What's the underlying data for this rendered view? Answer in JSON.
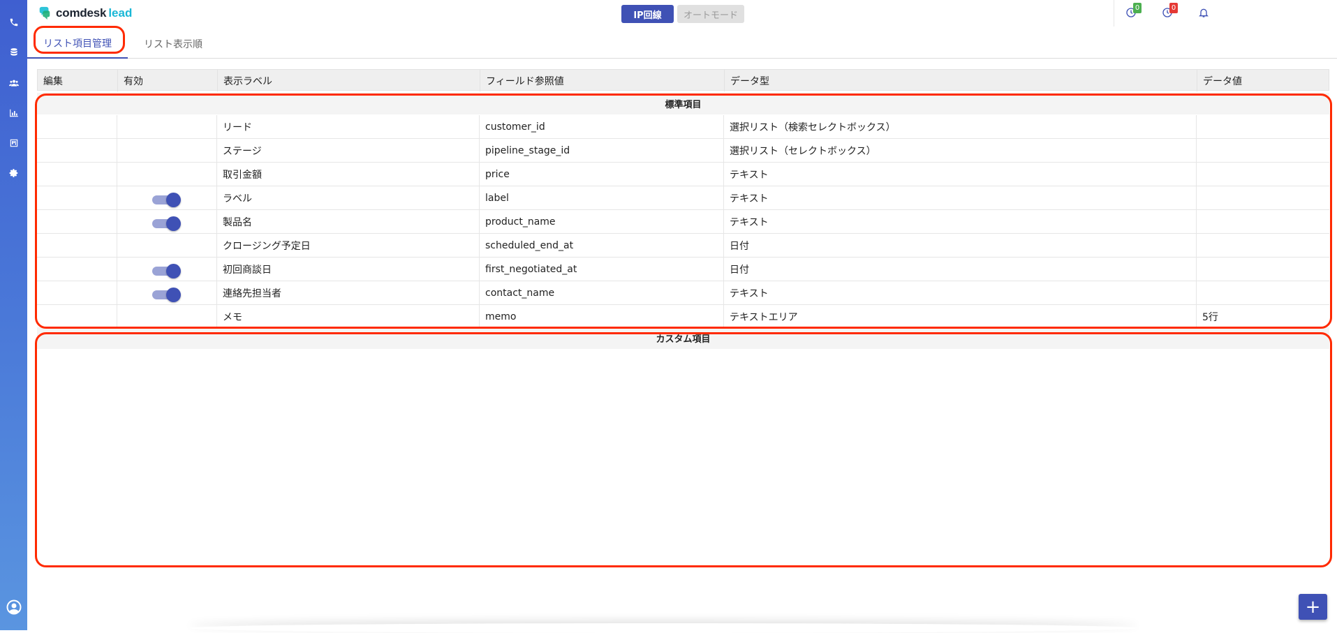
{
  "app": {
    "logo_text": "comdesk",
    "logo_accent": "lead"
  },
  "header": {
    "mode_ip": "IP回線",
    "mode_auto": "オートモード",
    "badge_1": "0",
    "badge_2": "0",
    "colors": {
      "primary": "#3f51b5",
      "badge_green": "#4caf50",
      "badge_red": "#e53935"
    }
  },
  "tabs": [
    {
      "label": "リスト項目管理",
      "active": true
    },
    {
      "label": "リスト表示順",
      "active": false
    }
  ],
  "table": {
    "columns": [
      "編集",
      "有効",
      "表示ラベル",
      "フィールド参照値",
      "データ型",
      "データ値"
    ],
    "standard_section_title": "標準項目",
    "custom_section_title": "カスタム項目",
    "rows": [
      {
        "enabled": false,
        "label": "リード",
        "field": "customer_id",
        "type": "選択リスト（検索セレクトボックス）",
        "value": ""
      },
      {
        "enabled": false,
        "label": "ステージ",
        "field": "pipeline_stage_id",
        "type": "選択リスト（セレクトボックス）",
        "value": ""
      },
      {
        "enabled": false,
        "label": "取引金額",
        "field": "price",
        "type": "テキスト",
        "value": ""
      },
      {
        "enabled": true,
        "label": "ラベル",
        "field": "label",
        "type": "テキスト",
        "value": ""
      },
      {
        "enabled": true,
        "label": "製品名",
        "field": "product_name",
        "type": "テキスト",
        "value": ""
      },
      {
        "enabled": false,
        "label": "クロージング予定日",
        "field": "scheduled_end_at",
        "type": "日付",
        "value": ""
      },
      {
        "enabled": true,
        "label": "初回商談日",
        "field": "first_negotiated_at",
        "type": "日付",
        "value": ""
      },
      {
        "enabled": true,
        "label": "連絡先担当者",
        "field": "contact_name",
        "type": "テキスト",
        "value": ""
      },
      {
        "enabled": false,
        "label": "メモ",
        "field": "memo",
        "type": "テキストエリア",
        "value": "5行"
      }
    ]
  },
  "fab": {
    "label": "+"
  },
  "sidebar_icons": [
    "phone-icon",
    "database-icon",
    "users-icon",
    "bar-chart-icon",
    "board-icon",
    "gear-icon",
    "account-icon"
  ]
}
